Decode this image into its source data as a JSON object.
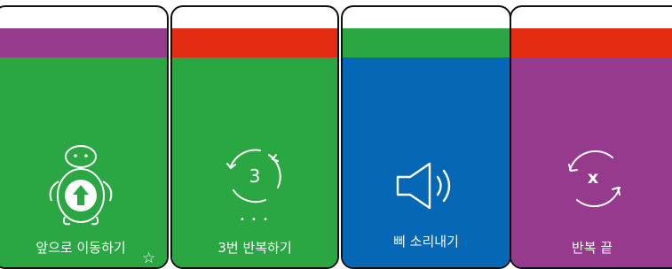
{
  "cards": [
    {
      "label": "앞으로 이동하기",
      "icon": "turtle-up-arrow-icon",
      "top_color": "#953a8c",
      "body_color": "#2aa642",
      "badge": "☆"
    },
    {
      "label": "3번 반복하기",
      "icon": "repeat-3-icon",
      "top_color": "#e42c12",
      "body_color": "#2aa642",
      "count": "3",
      "dots": "• • •"
    },
    {
      "label": "삐 소리내기",
      "icon": "speaker-icon",
      "top_color": "#2aa642",
      "body_color": "#0668b5"
    },
    {
      "label": "반복 끝",
      "icon": "repeat-end-icon",
      "top_color": "#e42c12",
      "body_color": "#953a8c",
      "mark": "x"
    }
  ]
}
